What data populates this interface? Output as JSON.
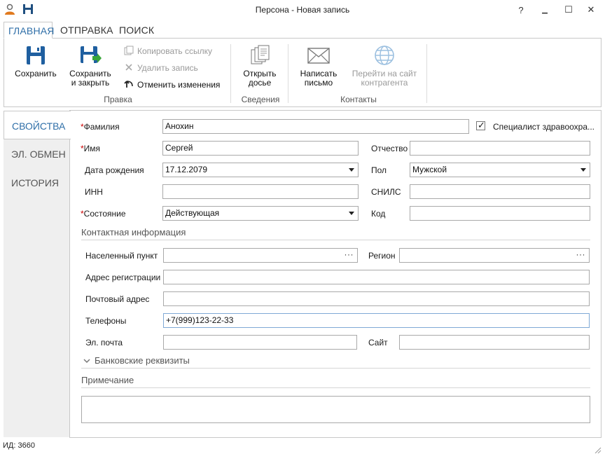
{
  "window": {
    "title": "Персона - Новая запись",
    "help": "?",
    "minimize": "▁",
    "maximize": "☐",
    "close": "✕"
  },
  "ribbon_tabs": [
    "ГЛАВНАЯ",
    "ОТПРАВКА",
    "ПОИСК"
  ],
  "ribbon": {
    "save": "Сохранить",
    "save_close_1": "Сохранить",
    "save_close_2": "и закрыть",
    "copy_link": "Копировать ссылку",
    "delete_record": "Удалить запись",
    "undo_changes": "Отменить изменения",
    "group_edit": "Правка",
    "open_dossier_1": "Открыть",
    "open_dossier_2": "досье",
    "group_info": "Сведения",
    "write_letter_1": "Написать",
    "write_letter_2": "письмо",
    "go_site_1": "Перейти на сайт",
    "go_site_2": "контрагента",
    "group_contacts": "Контакты"
  },
  "nav": [
    "СВОЙСТВА",
    "ЭЛ. ОБМЕН",
    "ИСТОРИЯ"
  ],
  "form": {
    "req_mark": "*",
    "lastname_label": "Фамилия",
    "lastname_value": "Анохин",
    "health_checkbox_label": "Специалист здравоохра...",
    "health_check_mark": "✓",
    "firstname_label": "Имя",
    "firstname_value": "Сергей",
    "patronymic_label": "Отчество",
    "patronymic_value": "",
    "birthdate_label": "Дата рождения",
    "birthdate_value": "17.12.2079",
    "gender_label": "Пол",
    "gender_value": "Мужской",
    "inn_label": "ИНН",
    "inn_value": "",
    "snils_label": "СНИЛС",
    "snils_value": "",
    "state_label": "Состояние",
    "state_value": "Действующая",
    "code_label": "Код",
    "code_value": ""
  },
  "contacts": {
    "section_title": "Контактная информация",
    "locality_label": "Населенный пункт",
    "region_label": "Регион",
    "ellipsis": "···",
    "reg_address_label": "Адрес регистрации",
    "postal_address_label": "Почтовый адрес",
    "phones_label": "Телефоны",
    "phones_value": "+7(999)123-22-33",
    "email_label": "Эл. почта",
    "site_label": "Сайт"
  },
  "bank": {
    "title": "Банковские реквизиты"
  },
  "note": {
    "title": "Примечание"
  },
  "status": {
    "id_text": "ИД: 3660"
  },
  "colors": {
    "accent": "#2f6fa8",
    "save_icon": "#1f5fa0",
    "save_close_arrow": "#3aa53a",
    "required": "#c00000"
  }
}
